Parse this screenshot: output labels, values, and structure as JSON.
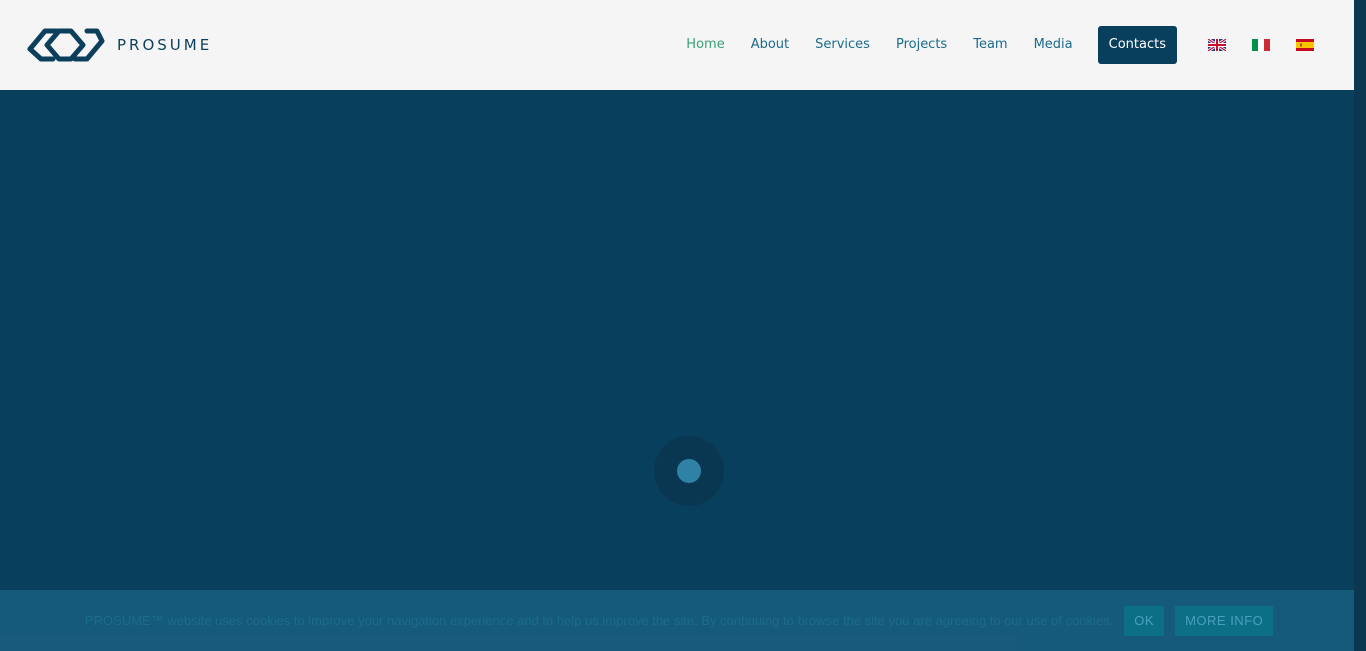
{
  "header": {
    "brand": "PROSUME",
    "nav": [
      {
        "label": "Home",
        "active": true
      },
      {
        "label": "About",
        "active": false
      },
      {
        "label": "Services",
        "active": false
      },
      {
        "label": "Projects",
        "active": false
      },
      {
        "label": "Team",
        "active": false
      },
      {
        "label": "Media",
        "active": false
      }
    ],
    "contacts_label": "Contacts",
    "languages": [
      "english-flag-icon",
      "italian-flag-icon",
      "spanish-flag-icon"
    ]
  },
  "cookie": {
    "text": "PROSUME™ website uses cookies to improve your navigation experience and to help us improve the site. By continuing to browse the site you are agreeing to our use of cookies.",
    "ok_label": "OK",
    "more_label": "MORE INFO"
  },
  "colors": {
    "primary": "#083f5c",
    "nav_link": "#1b6b8c",
    "nav_active": "#3aa07a",
    "header_bg": "#f5f5f5"
  }
}
